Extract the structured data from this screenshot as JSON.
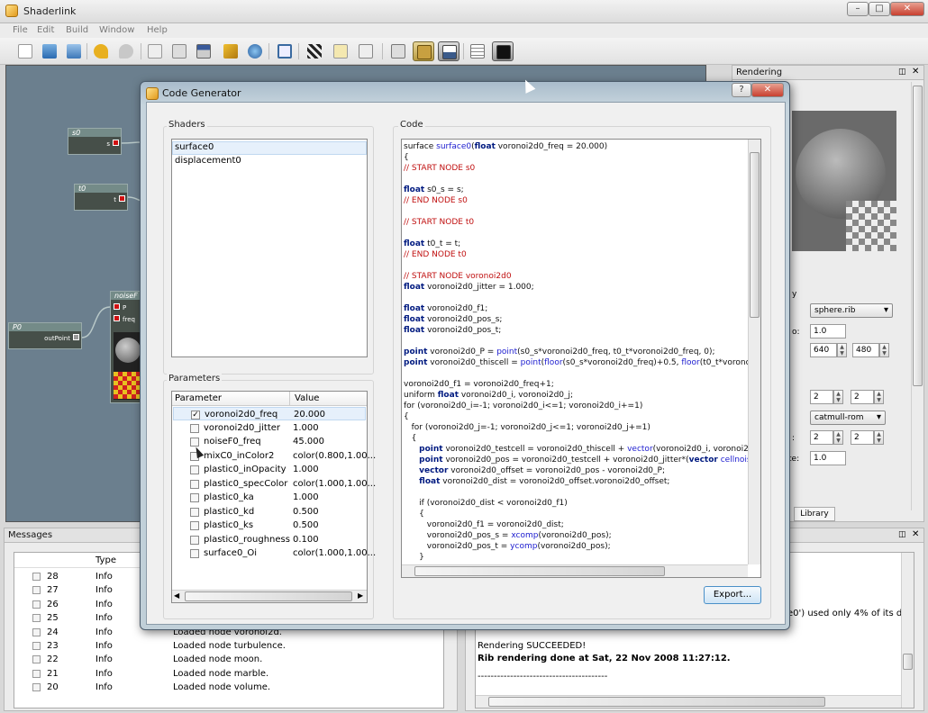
{
  "app": {
    "title": "Shaderlink"
  },
  "window_controls": {
    "minimize": "–",
    "maximize": "□",
    "close": "✕"
  },
  "menu": [
    "File",
    "Edit",
    "Build",
    "Window",
    "Help"
  ],
  "toolbar_icons": [
    "new-file-icon",
    "open-folder-icon",
    "save-icon",
    "undo-icon",
    "redo-icon",
    "copy-icon",
    "paste-icon",
    "properties-icon",
    "clean-brush-icon",
    "render-globe-icon",
    "fullscreen-icon",
    "clapper-icon",
    "edit-icon",
    "zoom-icon",
    "layout-icon",
    "toggle-panel-icon",
    "preview-icon",
    "list-view-icon",
    "console-icon"
  ],
  "nodes": {
    "s0": {
      "title": "s0",
      "port": "s"
    },
    "t0": {
      "title": "t0",
      "port": "t"
    },
    "p0": {
      "title": "P0",
      "port": "outPoint"
    },
    "noise": {
      "title": "noiseF",
      "ports": [
        "P",
        "freq"
      ]
    }
  },
  "rendering": {
    "title": "Rendering",
    "file_select": "sphere.rib",
    "value1": "1.0",
    "width": "640",
    "height": "480",
    "samples_x": "2",
    "samples_y": "2",
    "filter_select": "catmull-rom",
    "filter_x": "2",
    "filter_y": "2",
    "gain": "1.0",
    "label_partial_1": "y",
    "label_partial_2": "o:",
    "label_partial_3": ":",
    "label_partial_4": "te:",
    "library_tab": "Library"
  },
  "messages": {
    "title": "Messages",
    "columns": [
      "Type",
      ""
    ],
    "rows": [
      {
        "id": "28",
        "type": "Info",
        "text": ""
      },
      {
        "id": "27",
        "type": "Info",
        "text": ""
      },
      {
        "id": "26",
        "type": "Info",
        "text": ""
      },
      {
        "id": "25",
        "type": "Info",
        "text": ""
      },
      {
        "id": "24",
        "type": "Info",
        "text": "Loaded node voronoi2d."
      },
      {
        "id": "23",
        "type": "Info",
        "text": "Loaded node turbulence."
      },
      {
        "id": "22",
        "type": "Info",
        "text": "Loaded node moon."
      },
      {
        "id": "21",
        "type": "Info",
        "text": "Loaded node marble."
      },
      {
        "id": "20",
        "type": "Info",
        "text": "Loaded node volume."
      }
    ]
  },
  "render_log": {
    "line_partial": "e0') used only 4% of its displa",
    "success": "Rendering SUCCEEDED!",
    "done": "Rib rendering done at Sat, 22 Nov 2008 11:27:12.",
    "divider": "----------------------------------------"
  },
  "dialog": {
    "title": "Code Generator",
    "help": "?",
    "close": "✕",
    "shaders_label": "Shaders",
    "shaders": [
      "surface0",
      "displacement0"
    ],
    "parameters_label": "Parameters",
    "param_columns": [
      "Parameter",
      "Value"
    ],
    "params": [
      {
        "name": "voronoi2d0_freq",
        "value": "20.000",
        "checked": "✓"
      },
      {
        "name": "voronoi2d0_jitter",
        "value": "1.000",
        "checked": ""
      },
      {
        "name": "noiseF0_freq",
        "value": "45.000",
        "checked": ""
      },
      {
        "name": "mixC0_inColor2",
        "value": "color(0.800,1.00...",
        "checked": ""
      },
      {
        "name": "plastic0_inOpacity",
        "value": "1.000",
        "checked": ""
      },
      {
        "name": "plastic0_specColor",
        "value": "color(1.000,1.00...",
        "checked": ""
      },
      {
        "name": "plastic0_ka",
        "value": "1.000",
        "checked": ""
      },
      {
        "name": "plastic0_kd",
        "value": "0.500",
        "checked": ""
      },
      {
        "name": "plastic0_ks",
        "value": "0.500",
        "checked": ""
      },
      {
        "name": "plastic0_roughness",
        "value": "0.100",
        "checked": ""
      },
      {
        "name": "surface0_Oi",
        "value": "color(1.000,1.00...",
        "checked": ""
      }
    ],
    "code_label": "Code",
    "export_button": "Export...",
    "code_lines": [
      [
        [
          "",
          "surface "
        ],
        [
          "fn",
          "surface0"
        ],
        [
          "",
          "("
        ],
        [
          "kw",
          "float"
        ],
        [
          "",
          " voronoi2d0_freq = 20.000)"
        ]
      ],
      [
        [
          "",
          "{"
        ]
      ],
      [
        [
          "cm",
          "// START NODE s0"
        ]
      ],
      [
        [
          "",
          ""
        ]
      ],
      [
        [
          "kw",
          "float"
        ],
        [
          "",
          " s0_s = s;"
        ]
      ],
      [
        [
          "cm",
          "// END NODE s0"
        ]
      ],
      [
        [
          "",
          ""
        ]
      ],
      [
        [
          "cm",
          "// START NODE t0"
        ]
      ],
      [
        [
          "",
          ""
        ]
      ],
      [
        [
          "kw",
          "float"
        ],
        [
          "",
          " t0_t = t;"
        ]
      ],
      [
        [
          "cm",
          "// END NODE t0"
        ]
      ],
      [
        [
          "",
          ""
        ]
      ],
      [
        [
          "cm",
          "// START NODE voronoi2d0"
        ]
      ],
      [
        [
          "kw",
          "float"
        ],
        [
          "",
          " voronoi2d0_jitter = 1.000;"
        ]
      ],
      [
        [
          "",
          ""
        ]
      ],
      [
        [
          "kw",
          "float"
        ],
        [
          "",
          " voronoi2d0_f1;"
        ]
      ],
      [
        [
          "kw",
          "float"
        ],
        [
          "",
          " voronoi2d0_pos_s;"
        ]
      ],
      [
        [
          "kw",
          "float"
        ],
        [
          "",
          " voronoi2d0_pos_t;"
        ]
      ],
      [
        [
          "",
          ""
        ]
      ],
      [
        [
          "kw",
          "point"
        ],
        [
          "",
          " voronoi2d0_P = "
        ],
        [
          "fn",
          "point"
        ],
        [
          "",
          "(s0_s*voronoi2d0_freq, t0_t*voronoi2d0_freq, 0);"
        ]
      ],
      [
        [
          "kw",
          "point"
        ],
        [
          "",
          " voronoi2d0_thiscell = "
        ],
        [
          "fn",
          "point"
        ],
        [
          "",
          "("
        ],
        [
          "fn",
          "floor"
        ],
        [
          "",
          "(s0_s*voronoi2d0_freq)+0.5, "
        ],
        [
          "fn",
          "floor"
        ],
        [
          "",
          "(t0_t*voronoi2d0_"
        ]
      ],
      [
        [
          "",
          ""
        ]
      ],
      [
        [
          "",
          "voronoi2d0_f1 = voronoi2d0_freq+1;"
        ]
      ],
      [
        [
          "",
          "uniform "
        ],
        [
          "kw",
          "float"
        ],
        [
          "",
          " voronoi2d0_i, voronoi2d0_j;"
        ]
      ],
      [
        [
          "",
          "for (voronoi2d0_i=-1; voronoi2d0_i<=1; voronoi2d0_i+=1)"
        ]
      ],
      [
        [
          "",
          "{"
        ]
      ],
      [
        [
          "",
          "   for (voronoi2d0_j=-1; voronoi2d0_j<=1; voronoi2d0_j+=1)"
        ]
      ],
      [
        [
          "",
          "   {"
        ]
      ],
      [
        [
          "",
          "      "
        ],
        [
          "kw",
          "point"
        ],
        [
          "",
          " voronoi2d0_testcell = voronoi2d0_thiscell + "
        ],
        [
          "fn",
          "vector"
        ],
        [
          "",
          "(voronoi2d0_i, voronoi2d0_j, 0"
        ]
      ],
      [
        [
          "",
          "      "
        ],
        [
          "kw",
          "point"
        ],
        [
          "",
          " voronoi2d0_pos = voronoi2d0_testcell + voronoi2d0_jitter*("
        ],
        [
          "kw",
          "vector"
        ],
        [
          "",
          " "
        ],
        [
          "fn",
          "cellnoise"
        ],
        [
          "",
          "(vor"
        ]
      ],
      [
        [
          "",
          "      "
        ],
        [
          "kw",
          "vector"
        ],
        [
          "",
          " voronoi2d0_offset = voronoi2d0_pos - voronoi2d0_P;"
        ]
      ],
      [
        [
          "",
          "      "
        ],
        [
          "kw",
          "float"
        ],
        [
          "",
          " voronoi2d0_dist = voronoi2d0_offset.voronoi2d0_offset;"
        ]
      ],
      [
        [
          "",
          ""
        ]
      ],
      [
        [
          "",
          "      if (voronoi2d0_dist < voronoi2d0_f1)"
        ]
      ],
      [
        [
          "",
          "      {"
        ]
      ],
      [
        [
          "",
          "         voronoi2d0_f1 = voronoi2d0_dist;"
        ]
      ],
      [
        [
          "",
          "         voronoi2d0_pos_s = "
        ],
        [
          "fn",
          "xcomp"
        ],
        [
          "",
          "(voronoi2d0_pos);"
        ]
      ],
      [
        [
          "",
          "         voronoi2d0_pos_t = "
        ],
        [
          "fn",
          "ycomp"
        ],
        [
          "",
          "(voronoi2d0_pos);"
        ]
      ],
      [
        [
          "",
          "      }"
        ]
      ]
    ]
  }
}
